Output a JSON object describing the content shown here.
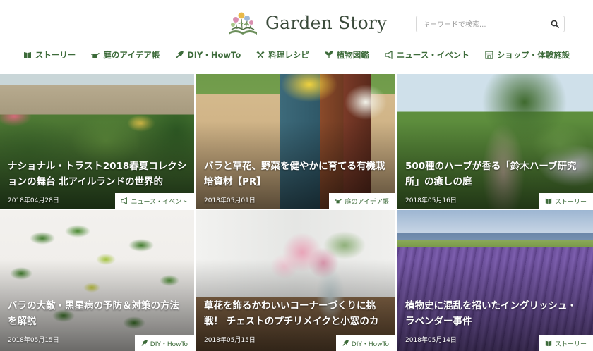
{
  "site": {
    "logo_text": "Garden Story"
  },
  "search": {
    "placeholder": "キーワードで検索..."
  },
  "nav": [
    {
      "label": "ストーリー",
      "icon": "book-icon"
    },
    {
      "label": "庭のアイデア帳",
      "icon": "watering-can-icon"
    },
    {
      "label": "DIY・HowTo",
      "icon": "trowel-icon"
    },
    {
      "label": "料理レシピ",
      "icon": "utensils-icon"
    },
    {
      "label": "植物図鑑",
      "icon": "sprout-icon"
    },
    {
      "label": "ニュース・イベント",
      "icon": "megaphone-icon"
    },
    {
      "label": "ショップ・体験施設",
      "icon": "shop-icon"
    }
  ],
  "articles": [
    {
      "title": "ナショナル・トラスト2018春夏コレクションの舞台 北アイルランドの世界的",
      "date": "2018年04月28日",
      "category": "ニュース・イベント",
      "category_icon": "megaphone-icon"
    },
    {
      "title": "バラと草花、野菜を健やかに育てる有機栽培資材【PR】",
      "date": "2018年05月01日",
      "category": "庭のアイデア帳",
      "category_icon": "watering-can-icon"
    },
    {
      "title": "500種のハーブが香る「鈴木ハーブ研究所」の癒しの庭",
      "date": "2018年05月16日",
      "category": "ストーリー",
      "category_icon": "book-icon"
    },
    {
      "title": "バラの大敵・黒星病の予防＆対策の方法を解説",
      "date": "2018年05月15日",
      "category": "DIY・HowTo",
      "category_icon": "trowel-icon"
    },
    {
      "title": "草花を飾るかわいいコーナーづくりに挑戦！ チェストのプチリメイクと小窓のカ",
      "date": "2018年05月15日",
      "category": "DIY・HowTo",
      "category_icon": "trowel-icon"
    },
    {
      "title": "植物史に混乱を招いたイングリッシュ・ラベンダー事件",
      "date": "2018年05月14日",
      "category": "ストーリー",
      "category_icon": "book-icon"
    }
  ],
  "colors": {
    "accent": "#3d6b3a",
    "badge_bg": "#ffffff"
  }
}
